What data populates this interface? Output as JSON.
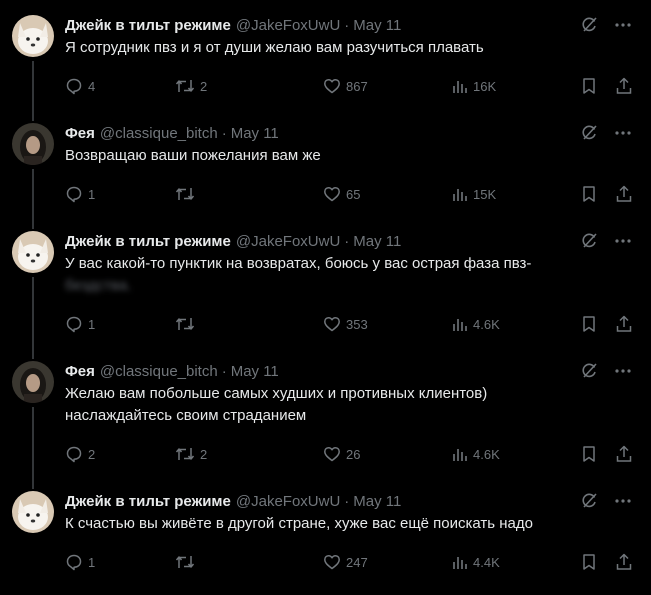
{
  "tweets": [
    {
      "author": "Джейк в тильт режиме",
      "handle": "@JakeFoxUwU",
      "separator": "·",
      "date": "May 11",
      "text": "Я сотрудник пвз и я от души желаю вам разучиться плавать",
      "text_blurred": "",
      "avatar_icon": "white-fox-icon",
      "replies": "4",
      "retweets": "2",
      "likes": "867",
      "views": "16K"
    },
    {
      "author": "Фея",
      "handle": "@classique_bitch",
      "separator": "·",
      "date": "May 11",
      "text": "Возвращаю ваши пожелания вам же",
      "text_blurred": "",
      "avatar_icon": "woman-photo-icon",
      "replies": "1",
      "retweets": "",
      "likes": "65",
      "views": "15K"
    },
    {
      "author": "Джейк в тильт режиме",
      "handle": "@JakeFoxUwU",
      "separator": "·",
      "date": "May 11",
      "text": "У вас какой-то пунктик на возвратах, боюсь у вас острая фаза пвз-",
      "text_blurred": "бездства.",
      "avatar_icon": "white-fox-icon",
      "replies": "1",
      "retweets": "",
      "likes": "353",
      "views": "4.6K"
    },
    {
      "author": "Фея",
      "handle": "@classique_bitch",
      "separator": "·",
      "date": "May 11",
      "text": "Желаю вам побольше самых худших и противных клиентов) наслаждайтесь своим страданием",
      "text_blurred": "",
      "avatar_icon": "woman-photo-icon",
      "replies": "2",
      "retweets": "2",
      "likes": "26",
      "views": "4.6K"
    },
    {
      "author": "Джейк в тильт режиме",
      "handle": "@JakeFoxUwU",
      "separator": "·",
      "date": "May 11",
      "text": "К счастью вы живёте в другой стране, хуже вас ещё поискать надо",
      "text_blurred": "",
      "avatar_icon": "white-fox-icon",
      "replies": "1",
      "retweets": "",
      "likes": "247",
      "views": "4.4K"
    }
  ],
  "colors": {
    "background": "#000000",
    "text": "#e7e9ea",
    "muted": "#71767b",
    "thread_line": "#333639"
  }
}
